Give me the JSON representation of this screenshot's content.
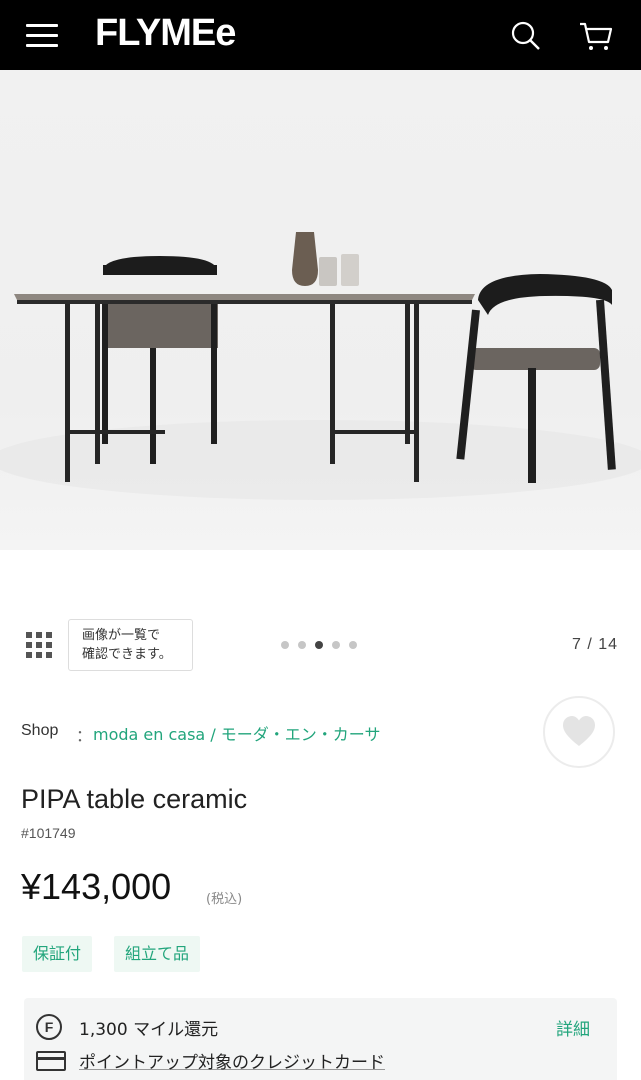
{
  "header": {
    "logo": "FLYMEe",
    "menu_icon": "hamburger-menu-icon",
    "search_icon": "search-icon",
    "cart_icon": "cart-icon",
    "background": "#000000"
  },
  "gallery": {
    "tooltip_line1": "画像が一覧で",
    "tooltip_line2": "確認できます。",
    "dots_total": 5,
    "dots_active_index": 2,
    "counter": "7 / 14"
  },
  "shop": {
    "label": "Shop",
    "separator": "：",
    "link": "moda en casa / モーダ・エン・カーサ"
  },
  "product": {
    "title": "PIPA table ceramic",
    "code": "#101749",
    "price": "¥143,000",
    "tax": "(税込)",
    "tags": [
      "保証付",
      "組立て品"
    ]
  },
  "mileage": {
    "icon_letter": "F",
    "text": "1,300 マイル還元",
    "detail": "詳細",
    "card_text": "ポイントアップ対象のクレジットカード"
  },
  "colors": {
    "accent": "#22a57c",
    "tag_bg": "#eef8f3",
    "box_bg": "#f4f5f5"
  }
}
